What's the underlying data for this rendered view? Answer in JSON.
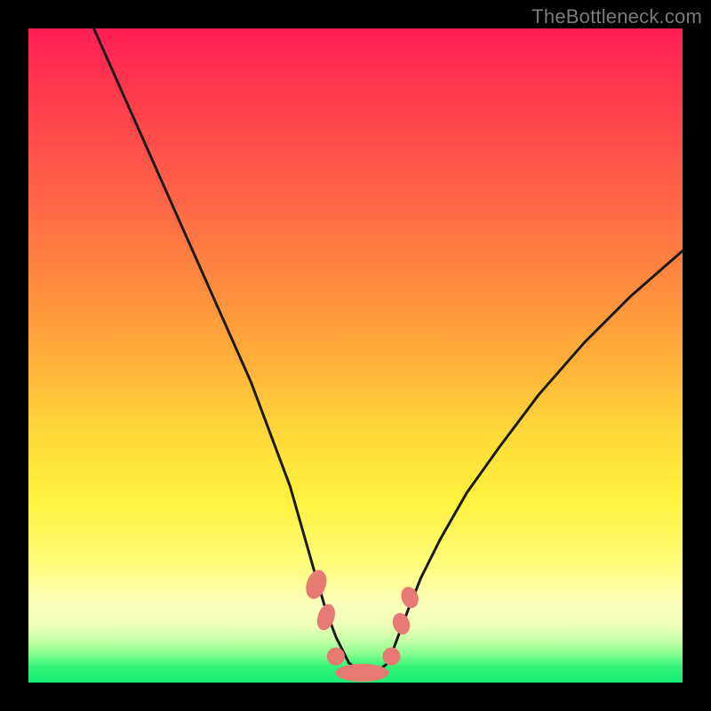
{
  "watermark": "TheBottleneck.com",
  "chart_data": {
    "type": "line",
    "title": "",
    "xlabel": "",
    "ylabel": "",
    "xlim": [
      0,
      100
    ],
    "ylim": [
      0,
      100
    ],
    "series": [
      {
        "name": "curve",
        "x": [
          10,
          14,
          18,
          22,
          26,
          30,
          34,
          37,
          40,
          42,
          44,
          45.5,
          47,
          49,
          51,
          53,
          55,
          56.5,
          58,
          60,
          63,
          67,
          72,
          78,
          85,
          92,
          100
        ],
        "values": [
          100,
          91,
          82,
          73,
          64,
          55,
          46,
          38,
          30,
          23,
          16,
          11,
          7,
          3,
          1.5,
          1.5,
          3,
          7,
          11,
          16,
          22,
          29,
          36,
          44,
          52,
          59,
          66
        ]
      }
    ],
    "markers": [
      {
        "shape": "pill",
        "cx": 44.0,
        "cy": 15.0,
        "rx": 1.4,
        "ry": 2.2,
        "rot": 18
      },
      {
        "shape": "pill",
        "cx": 45.5,
        "cy": 10.0,
        "rx": 1.2,
        "ry": 2.0,
        "rot": 18
      },
      {
        "shape": "round",
        "cx": 47.0,
        "cy": 4.0,
        "rx": 1.3,
        "ry": 1.3,
        "rot": 0
      },
      {
        "shape": "pill",
        "cx": 51.0,
        "cy": 1.5,
        "rx": 4.0,
        "ry": 1.3,
        "rot": 0
      },
      {
        "shape": "round",
        "cx": 55.5,
        "cy": 4.0,
        "rx": 1.3,
        "ry": 1.3,
        "rot": 0
      },
      {
        "shape": "round",
        "cx": 57.0,
        "cy": 9.0,
        "rx": 1.2,
        "ry": 1.6,
        "rot": -20
      },
      {
        "shape": "round",
        "cx": 58.3,
        "cy": 13.0,
        "rx": 1.2,
        "ry": 1.6,
        "rot": -20
      }
    ],
    "colors": {
      "curve": "#1b1b1b",
      "marker_fill": "#e77b73",
      "marker_stroke": "#e77b73"
    }
  }
}
